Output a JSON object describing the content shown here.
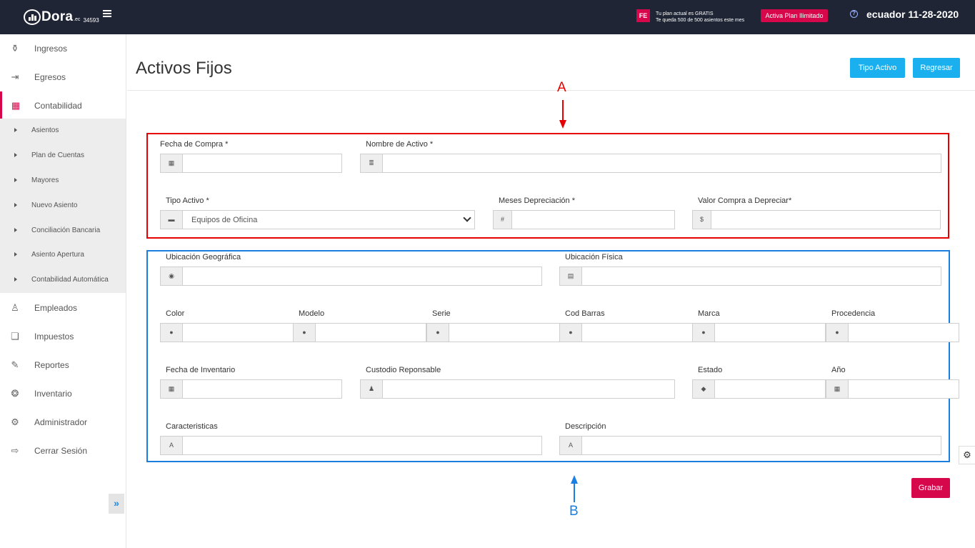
{
  "topbar": {
    "logo": "Dora",
    "logo_sub": ".ec",
    "logo_num": "34593",
    "fe_badge": "FE",
    "plan_line1": "Tu plan actual es GRATIS",
    "plan_line2": "Te queda 500 de 500 asientos este mes",
    "plan_button": "Activa Plan Ilimitado",
    "help": "?",
    "date": "ecuador 11-28-2020"
  },
  "sidebar": {
    "items": [
      {
        "label": "Ingresos",
        "icon": "⚱"
      },
      {
        "label": "Egresos",
        "icon": "⇥"
      },
      {
        "label": "Contabilidad",
        "icon": "▦"
      },
      {
        "label": "Empleados",
        "icon": "♙"
      },
      {
        "label": "Impuestos",
        "icon": "❏"
      },
      {
        "label": "Reportes",
        "icon": "✎"
      },
      {
        "label": "Inventario",
        "icon": "❂"
      },
      {
        "label": "Administrador",
        "icon": "⚙"
      },
      {
        "label": "Cerrar Sesión",
        "icon": "⇨"
      }
    ],
    "submenu": [
      "Asientos",
      "Plan de Cuentas",
      "Mayores",
      "Nuevo Asiento",
      "Conciliación Bancaria",
      "Asiento Apertura",
      "Contabilidad Automática"
    ],
    "collapse": "»"
  },
  "main": {
    "title": "Activos Fijos",
    "btn_tipo": "Tipo Activo",
    "btn_regresar": "Regresar",
    "btn_grabar": "Grabar",
    "gear": "⚙"
  },
  "annotations": {
    "a_label": "A",
    "b_label": "B",
    "a_color": "#e60000",
    "b_color": "#1a7fe0"
  },
  "form": {
    "fecha_compra": {
      "label": "Fecha de Compra *",
      "icon": "▦",
      "value": ""
    },
    "nombre_activo": {
      "label": "Nombre de Activo *",
      "icon": "≣",
      "value": ""
    },
    "tipo_activo": {
      "label": "Tipo Activo *",
      "icon": "▬",
      "value": "Equipos de Oficina"
    },
    "meses_depreciacion": {
      "label": "Meses Depreciación *",
      "icon": "#",
      "value": ""
    },
    "valor_compra": {
      "label": "Valor Compra a Depreciar*",
      "icon": "$",
      "value": ""
    },
    "ubicacion_geo": {
      "label": "Ubicación Geográfica",
      "icon": "◉",
      "value": ""
    },
    "ubicacion_fisica": {
      "label": "Ubicación Física",
      "icon": "▤",
      "value": ""
    },
    "color": {
      "label": "Color",
      "icon": "●",
      "value": ""
    },
    "modelo": {
      "label": "Modelo",
      "icon": "●",
      "value": ""
    },
    "serie": {
      "label": "Serie",
      "icon": "●",
      "value": ""
    },
    "cod_barras": {
      "label": "Cod Barras",
      "icon": "●",
      "value": ""
    },
    "marca": {
      "label": "Marca",
      "icon": "●",
      "value": ""
    },
    "procedencia": {
      "label": "Procedencia",
      "icon": "●",
      "value": ""
    },
    "fecha_inventario": {
      "label": "Fecha de Inventario",
      "icon": "▦",
      "value": ""
    },
    "custodio": {
      "label": "Custodio Reponsable",
      "icon": "♟",
      "value": ""
    },
    "estado": {
      "label": "Estado",
      "icon": "◆",
      "value": ""
    },
    "anio": {
      "label": "Año",
      "icon": "▦",
      "value": ""
    },
    "caracteristicas": {
      "label": "Caracteristicas",
      "icon": "A",
      "value": ""
    },
    "descripcion": {
      "label": "Descripción",
      "icon": "A",
      "value": ""
    }
  }
}
